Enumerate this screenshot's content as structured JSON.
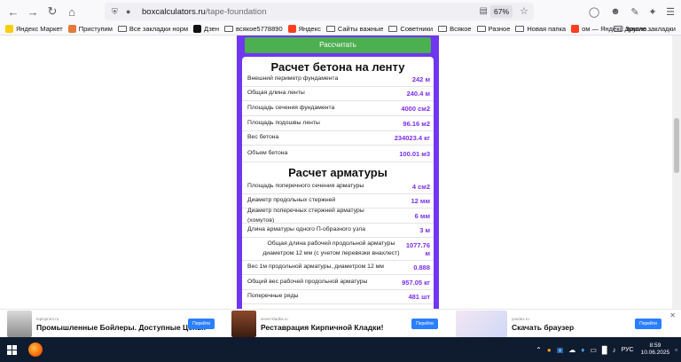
{
  "browser": {
    "url_domain": "boxcalculators.ru",
    "url_path": "/tape-foundation",
    "zoom": "67%"
  },
  "bookmarks": {
    "items": [
      {
        "label": "Яндекс Маркет",
        "color": "#ffcc00",
        "type": "site"
      },
      {
        "label": "Приступим",
        "color": "#e57a3c",
        "type": "site"
      },
      {
        "label": "Все закладки норм",
        "type": "folder"
      },
      {
        "label": "Дзен",
        "color": "#111111",
        "type": "site"
      },
      {
        "label": "всякое5778890",
        "type": "folder"
      },
      {
        "label": "Яндекс",
        "color": "#fc3f1d",
        "type": "site"
      },
      {
        "label": "Сайты важные",
        "type": "folder"
      },
      {
        "label": "Советники",
        "type": "folder"
      },
      {
        "label": "Всякое",
        "type": "folder"
      },
      {
        "label": "Разное",
        "type": "folder"
      },
      {
        "label": "Новая папка",
        "type": "folder"
      },
      {
        "label": "ом — Яндекс: нашло...",
        "color": "#fc3f1d",
        "type": "site"
      }
    ],
    "other": "Другие закладки"
  },
  "page": {
    "calc_button": "Рассчитать",
    "concrete_title": "Расчет бетона на ленту",
    "concrete_rows": [
      {
        "label": "Внешний периметр фундамента",
        "value": "242 м"
      },
      {
        "label": "Общая длина ленты",
        "value": "240.4 м"
      },
      {
        "label": "Площадь сечения фундамента",
        "value": "4000 см2"
      },
      {
        "label": "Площадь подошвы ленты",
        "value": "96.16 м2"
      },
      {
        "label": "Вес бетона",
        "value": "234023.4 кг"
      },
      {
        "label": "Объем бетона",
        "value": "100.01 м3"
      }
    ],
    "rebar_title": "Расчет арматуры",
    "rebar_rows": [
      {
        "label": "Площадь поперечного сечения арматуры",
        "value": "4 см2"
      },
      {
        "label": "Диаметр продольных стержней",
        "value": "12 мм"
      },
      {
        "label": "Диаметр поперечных стержней арматуры (хомутов)",
        "value": "6 мм"
      },
      {
        "label": "Длина арматуры одного П-образного узла",
        "value": "3 м"
      },
      {
        "label": "Общая длина рабочей продольной арматуры диаметром 12 мм (с учетом перевязки внахлест)",
        "value": "1077.76 м"
      },
      {
        "label": "Вес 1м продольной арматуры, диаметром 12 мм",
        "value": "0.888"
      },
      {
        "label": "Общий вес рабочей продольной арматуры",
        "value": "957.05 кг"
      },
      {
        "label": "Поперечные ряды",
        "value": "481 шт"
      }
    ],
    "accent_color": "#6f37f0",
    "value_color": "#7b2ff0"
  },
  "ads": [
    {
      "source": "teploprom.ru",
      "title": "Промышленные Бойлеры. Доступные Цены!",
      "button": "Перейти"
    },
    {
      "source": "sever-kladka.ru",
      "title": "Реставрация Кирпичной Кладки!",
      "button": "Перейти"
    },
    {
      "source": "yandex.ru",
      "title": "Скачать браузер",
      "button": "Перейти"
    }
  ],
  "taskbar": {
    "lang": "РУС",
    "time": "8:59",
    "date": "10.06.2025"
  }
}
